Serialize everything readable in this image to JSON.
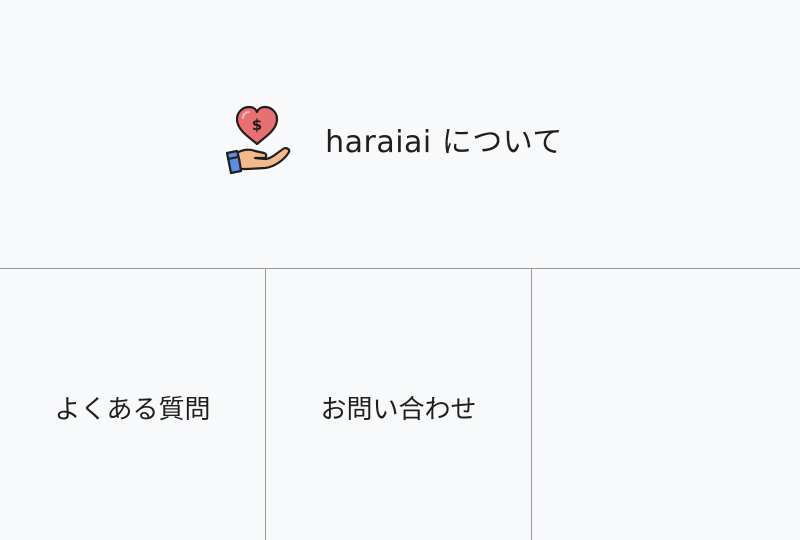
{
  "about": {
    "label": "haraiai について",
    "logo_icon": "heart-money-hand-icon"
  },
  "menu": {
    "items": [
      {
        "label": "よくある質問"
      },
      {
        "label": "お問い合わせ"
      },
      {
        "label": ""
      }
    ]
  },
  "colors": {
    "background": "#f8f9fa",
    "divider": "#9a9a9a",
    "heart": "#e86f72",
    "hand": "#f4b98a",
    "cuff": "#5c8de0",
    "outline": "#1f1f1f"
  }
}
